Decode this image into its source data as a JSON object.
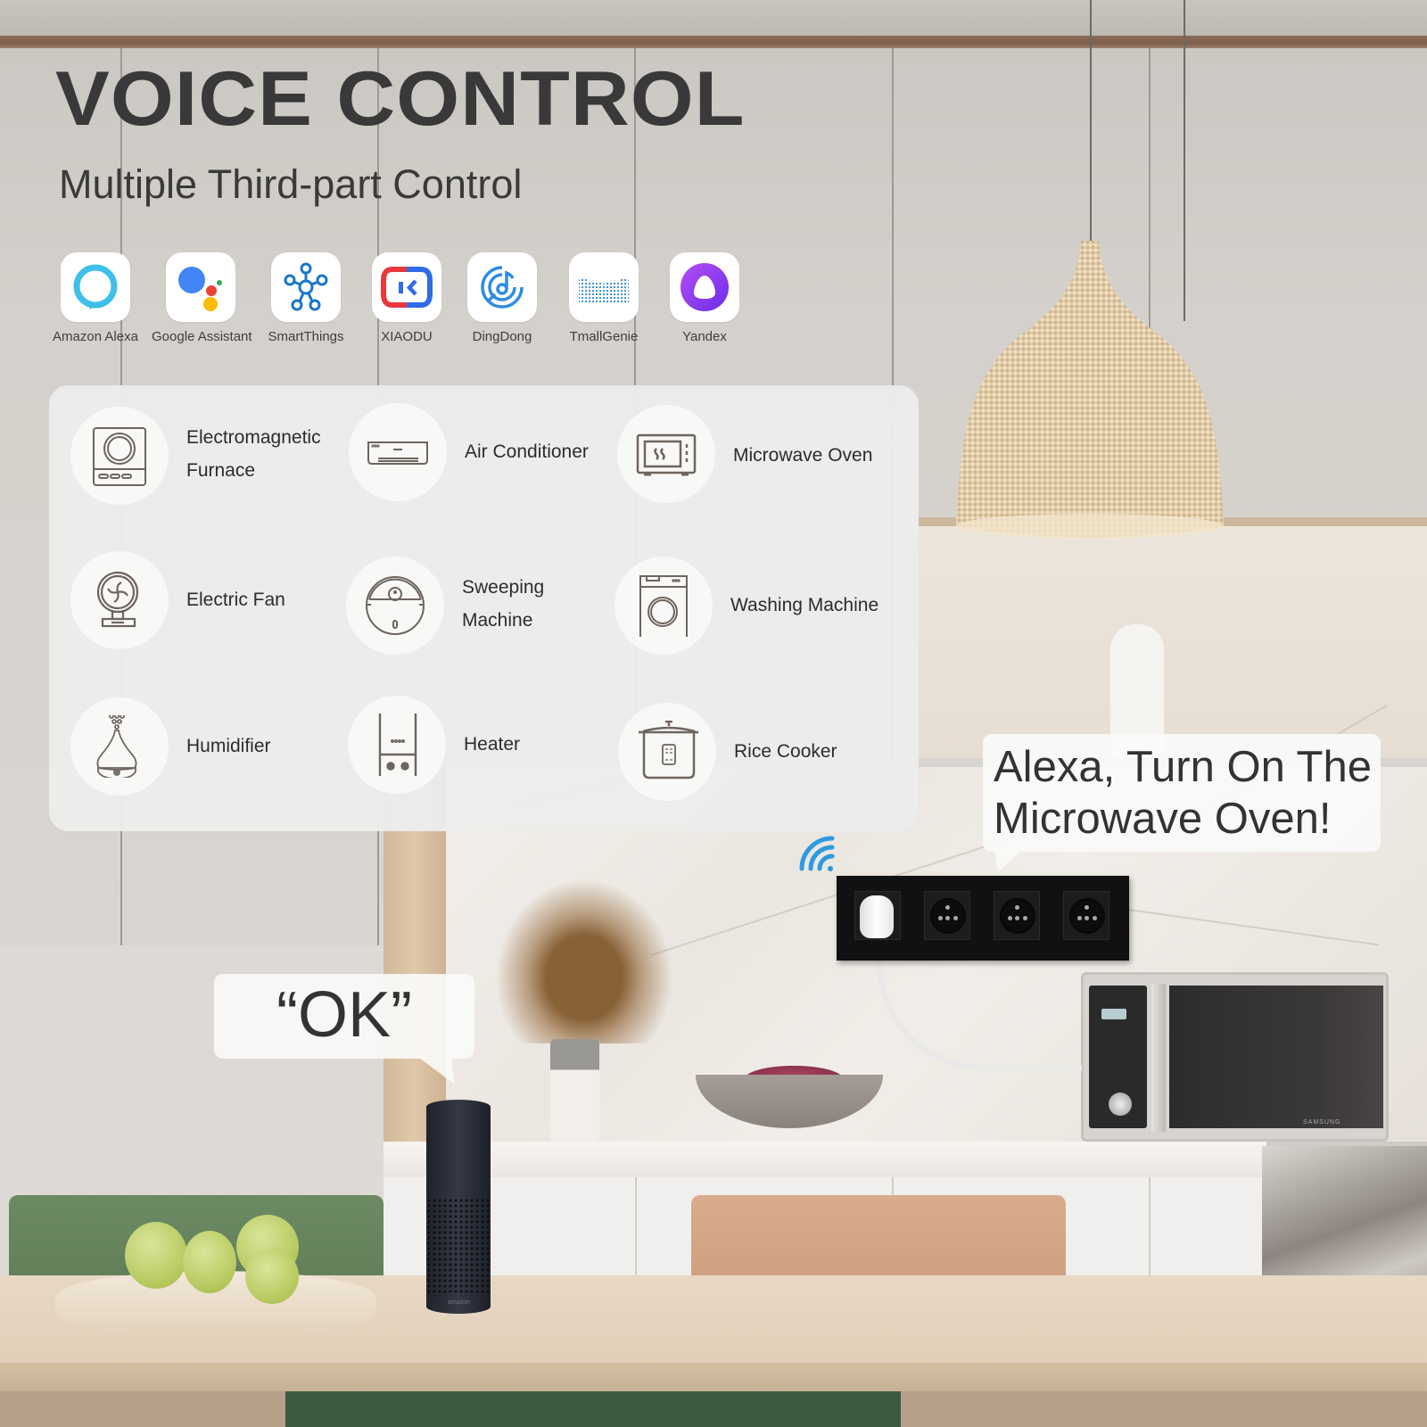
{
  "header": {
    "title": "VOICE CONTROL",
    "subtitle": "Multiple Third-part Control"
  },
  "assistants": [
    {
      "label": "Amazon Alexa",
      "icon": "amazon-alexa-icon"
    },
    {
      "label": "Google Assistant",
      "icon": "google-assistant-icon"
    },
    {
      "label": "SmartThings",
      "icon": "smartthings-icon"
    },
    {
      "label": "XIAODU",
      "icon": "xiaodu-icon"
    },
    {
      "label": "DingDong",
      "icon": "dingdong-icon"
    },
    {
      "label": "TmallGenie",
      "icon": "tmallgenie-icon"
    },
    {
      "label": "Yandex",
      "icon": "yandex-icon"
    }
  ],
  "devices": [
    {
      "label_lines": [
        "Electromagnetic",
        "Furnace"
      ],
      "icon": "induction-cooker-icon"
    },
    {
      "label_lines": [
        "Air Conditioner"
      ],
      "icon": "air-conditioner-icon"
    },
    {
      "label_lines": [
        "Microwave Oven"
      ],
      "icon": "microwave-icon"
    },
    {
      "label_lines": [
        "Electric Fan"
      ],
      "icon": "fan-icon"
    },
    {
      "label_lines": [
        "Sweeping",
        "Machine"
      ],
      "icon": "robot-vacuum-icon"
    },
    {
      "label_lines": [
        "Washing Machine"
      ],
      "icon": "washing-machine-icon"
    },
    {
      "label_lines": [
        "Humidifier"
      ],
      "icon": "humidifier-icon"
    },
    {
      "label_lines": [
        "Heater"
      ],
      "icon": "heater-icon"
    },
    {
      "label_lines": [
        "Rice Cooker"
      ],
      "icon": "rice-cooker-icon"
    }
  ],
  "speech": {
    "alexa_line1": "Alexa, Turn On The",
    "alexa_line2": "Microwave Oven!",
    "response": "“OK”"
  },
  "scene": {
    "echo_brand": "amazon",
    "microwave_brand": "SAMSUNG",
    "socket_count": 4
  },
  "colors": {
    "title": "#393939",
    "icon_stroke": "#6e655d",
    "wifi": "#2d9ae0",
    "alexa": "#3fc0e8",
    "yandex": "#8a3ff0"
  }
}
